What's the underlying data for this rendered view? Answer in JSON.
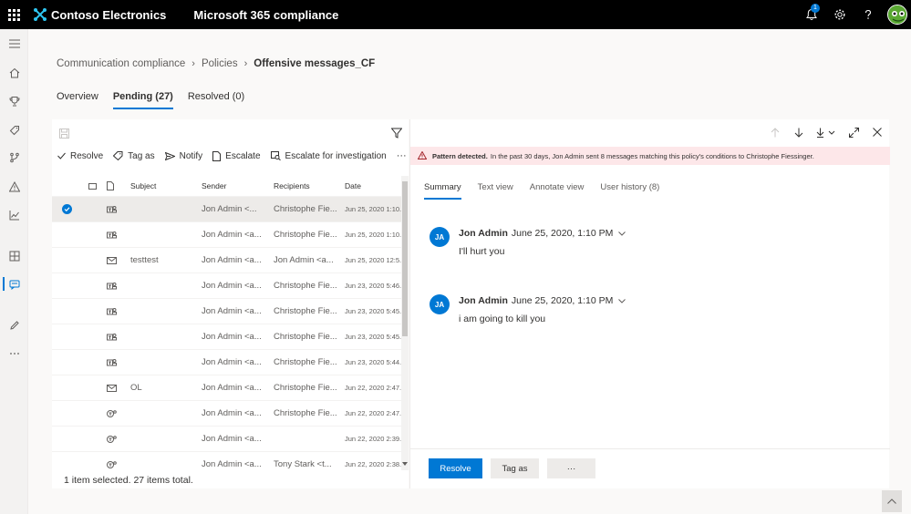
{
  "topbar": {
    "org_name": "Contoso Electronics",
    "app_name": "Microsoft 365 compliance",
    "notification_count": "1"
  },
  "breadcrumb": {
    "items": [
      "Communication compliance",
      "Policies",
      "Offensive messages_CF"
    ]
  },
  "tabs": [
    {
      "label": "Overview",
      "active": false
    },
    {
      "label": "Pending (27)",
      "active": true
    },
    {
      "label": "Resolved (0)",
      "active": false
    }
  ],
  "toolbar": {
    "resolve": "Resolve",
    "tag_as": "Tag as",
    "notify": "Notify",
    "escalate": "Escalate",
    "escalate_investigation": "Escalate for investigation",
    "more": "···"
  },
  "table": {
    "headers": {
      "subject": "Subject",
      "sender": "Sender",
      "recipients": "Recipients",
      "date": "Date"
    },
    "rows": [
      {
        "type": "teams",
        "subject": "",
        "sender": "Jon Admin <...",
        "recipients": "Christophe Fie...",
        "date": "Jun 25, 2020 1:10...",
        "selected": true
      },
      {
        "type": "teams",
        "subject": "",
        "sender": "Jon Admin <a...",
        "recipients": "Christophe Fie...",
        "date": "Jun 25, 2020 1:10...",
        "selected": false
      },
      {
        "type": "mail",
        "subject": "testtest",
        "sender": "Jon Admin <a...",
        "recipients": "Jon Admin <a...",
        "date": "Jun 25, 2020 12:5...",
        "selected": false
      },
      {
        "type": "teams",
        "subject": "",
        "sender": "Jon Admin <a...",
        "recipients": "Christophe Fie...",
        "date": "Jun 23, 2020 5:46...",
        "selected": false
      },
      {
        "type": "teams",
        "subject": "",
        "sender": "Jon Admin <a...",
        "recipients": "Christophe Fie...",
        "date": "Jun 23, 2020 5:45...",
        "selected": false
      },
      {
        "type": "teams",
        "subject": "",
        "sender": "Jon Admin <a...",
        "recipients": "Christophe Fie...",
        "date": "Jun 23, 2020 5:45...",
        "selected": false
      },
      {
        "type": "teams",
        "subject": "",
        "sender": "Jon Admin <a...",
        "recipients": "Christophe Fie...",
        "date": "Jun 23, 2020 5:44...",
        "selected": false
      },
      {
        "type": "mail",
        "subject": "OL",
        "sender": "Jon Admin <a...",
        "recipients": "Christophe Fie...",
        "date": "Jun 22, 2020 2:47...",
        "selected": false
      },
      {
        "type": "teams2",
        "subject": "",
        "sender": "Jon Admin <a...",
        "recipients": "Christophe Fie...",
        "date": "Jun 22, 2020 2:47...",
        "selected": false
      },
      {
        "type": "teams2",
        "subject": "",
        "sender": "Jon Admin <a...",
        "recipients": "",
        "date": "Jun 22, 2020 2:39...",
        "selected": false
      },
      {
        "type": "teams2",
        "subject": "",
        "sender": "Jon Admin <a...",
        "recipients": "Tony Stark <t...",
        "date": "Jun 22, 2020 2:38...",
        "selected": false
      }
    ]
  },
  "footer": {
    "status": "1 item selected.  27 items total."
  },
  "detail": {
    "alert_title": "Pattern detected.",
    "alert_text": "In the past 30 days, Jon Admin sent 8 messages matching this policy's conditions to Christophe Fiessinger.",
    "tabs": [
      {
        "label": "Summary",
        "active": true
      },
      {
        "label": "Text view",
        "active": false
      },
      {
        "label": "Annotate view",
        "active": false
      },
      {
        "label": "User history (8)",
        "active": false
      }
    ],
    "messages": [
      {
        "initials": "JA",
        "sender": "Jon Admin",
        "time": "June 25, 2020, 1:10 PM",
        "body": "I'll hurt you"
      },
      {
        "initials": "JA",
        "sender": "Jon Admin",
        "time": "June 25, 2020, 1:10 PM",
        "body": "i am going to kill you"
      }
    ],
    "buttons": {
      "resolve": "Resolve",
      "tag_as": "Tag as",
      "more": "···"
    }
  },
  "colors": {
    "accent": "#0078d4",
    "alert_bg": "#fde7e9",
    "topbar": "#000000"
  }
}
